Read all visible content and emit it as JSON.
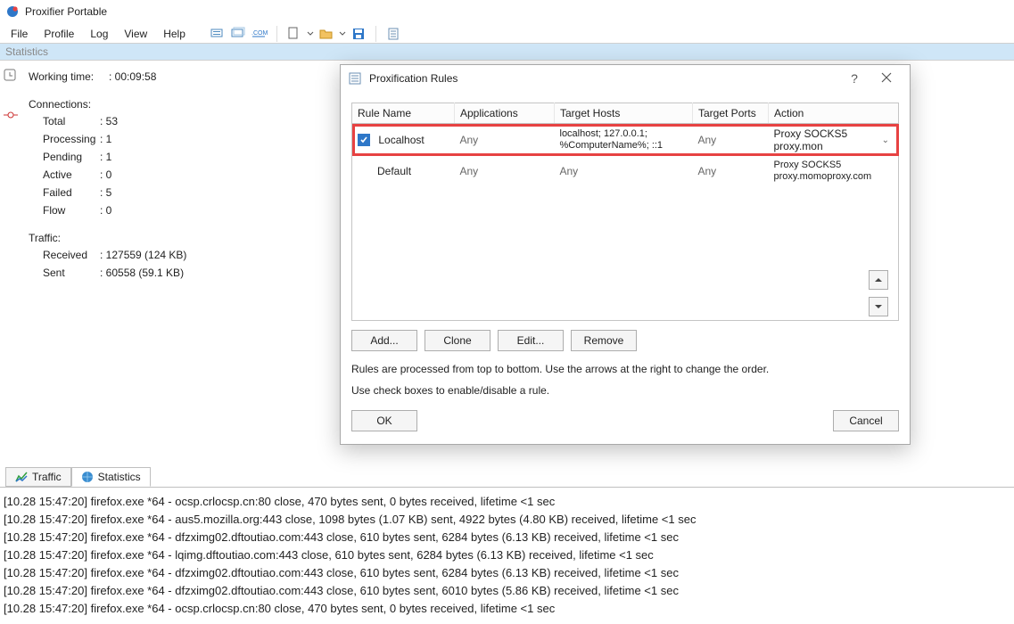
{
  "app": {
    "title": "Proxifier Portable"
  },
  "menu": {
    "items": [
      "File",
      "Profile",
      "Log",
      "View",
      "Help"
    ]
  },
  "stats_header": "Statistics",
  "stats": {
    "working_time_label": "Working time:",
    "working_time_val": ": 00:09:58",
    "connections_label": "Connections:",
    "rows": [
      {
        "label": "Total",
        "val": ": 53"
      },
      {
        "label": "Processing",
        "val": ": 1"
      },
      {
        "label": "Pending",
        "val": ": 1"
      },
      {
        "label": "Active",
        "val": ": 0"
      },
      {
        "label": "Failed",
        "val": ": 5"
      },
      {
        "label": "Flow",
        "val": ": 0"
      }
    ],
    "traffic_label": "Traffic:",
    "traffic": [
      {
        "label": "Received",
        "val": ": 127559   (124 KB)"
      },
      {
        "label": "Sent",
        "val": ": 60558   (59.1 KB)"
      }
    ]
  },
  "tabs": {
    "traffic": "Traffic",
    "statistics": "Statistics"
  },
  "log_lines": [
    "[10.28 15:47:20] firefox.exe *64 - ocsp.crlocsp.cn:80 close, 470 bytes sent, 0 bytes received, lifetime <1 sec",
    "[10.28 15:47:20] firefox.exe *64 - aus5.mozilla.org:443 close, 1098 bytes (1.07 KB) sent, 4922 bytes (4.80 KB) received, lifetime <1 sec",
    "[10.28 15:47:20] firefox.exe *64 - dfzximg02.dftoutiao.com:443 close, 610 bytes sent, 6284 bytes (6.13 KB) received, lifetime <1 sec",
    "[10.28 15:47:20] firefox.exe *64 - lqimg.dftoutiao.com:443 close, 610 bytes sent, 6284 bytes (6.13 KB) received, lifetime <1 sec",
    "[10.28 15:47:20] firefox.exe *64 - dfzximg02.dftoutiao.com:443 close, 610 bytes sent, 6284 bytes (6.13 KB) received, lifetime <1 sec",
    "[10.28 15:47:20] firefox.exe *64 - dfzximg02.dftoutiao.com:443 close, 610 bytes sent, 6010 bytes (5.86 KB) received, lifetime <1 sec",
    "[10.28 15:47:20] firefox.exe *64 - ocsp.crlocsp.cn:80 close, 470 bytes sent, 0 bytes received, lifetime <1 sec"
  ],
  "dialog": {
    "title": "Proxification Rules",
    "columns": [
      "Rule Name",
      "Applications",
      "Target Hosts",
      "Target Ports",
      "Action"
    ],
    "rows": [
      {
        "name": "Localhost",
        "apps": "Any",
        "hosts": "localhost; 127.0.0.1; %ComputerName%; ::1",
        "ports": "Any",
        "action": "Proxy SOCKS5 proxy.mon",
        "highlighted": true,
        "checked": true,
        "indent": false
      },
      {
        "name": "Default",
        "apps": "Any",
        "hosts": "Any",
        "ports": "Any",
        "action": "Proxy SOCKS5 proxy.momoproxy.com",
        "highlighted": false,
        "checked": false,
        "indent": true
      }
    ],
    "buttons": {
      "add": "Add...",
      "clone": "Clone",
      "edit": "Edit...",
      "remove": "Remove"
    },
    "help_line1": "Rules are processed from top to bottom. Use the arrows at the right to change the order.",
    "help_line2": "Use check boxes to enable/disable a rule.",
    "ok": "OK",
    "cancel": "Cancel"
  }
}
